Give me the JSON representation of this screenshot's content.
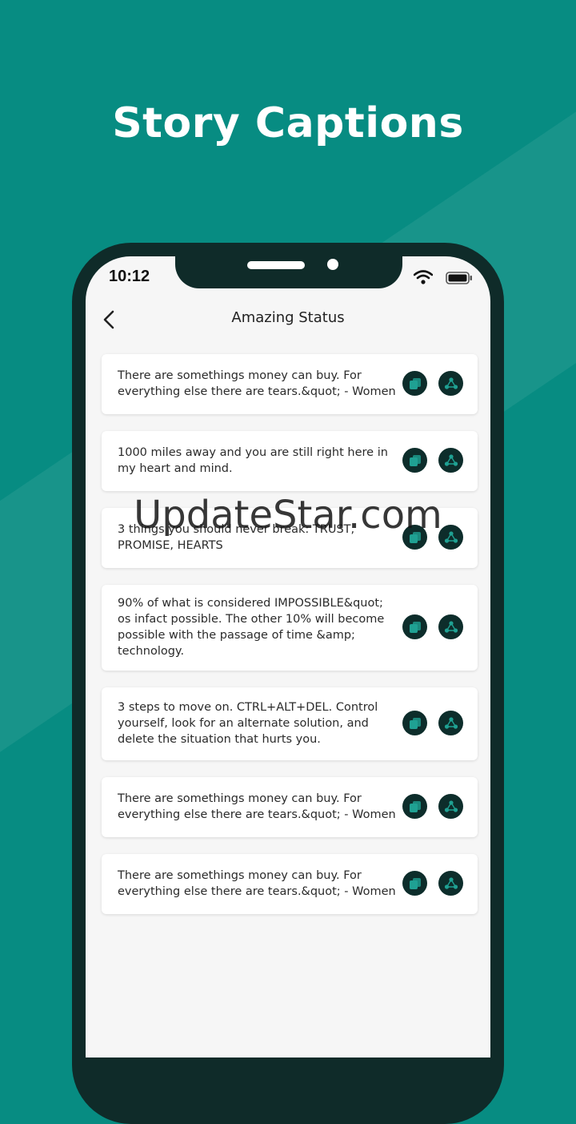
{
  "promo": {
    "title": "Story Captions"
  },
  "status_bar": {
    "time": "10:12"
  },
  "app_bar": {
    "title": "Amazing Status",
    "back_icon": "chevron-left-icon"
  },
  "captions": [
    {
      "text": "There are somethings money can buy. For everything else there are tears.&quot; - Women"
    },
    {
      "text": "1000 miles away and you are still right here in my heart and mind."
    },
    {
      "text": "3 things you should never break: TRUST, PROMISE, HEARTS"
    },
    {
      "text": "90% of what is considered IMPOSSIBLE&quot; os infact possible. The other 10% will become possible with the passage of time &amp; technology."
    },
    {
      "text": "3 steps to move on. CTRL+ALT+DEL. Control yourself, look for an alternate solution, and delete the situation that hurts you."
    },
    {
      "text": "There are somethings money can buy. For everything else there are tears.&quot; - Women"
    },
    {
      "text": "There are somethings money can buy. For everything else there are tears.&quot; - Women"
    }
  ],
  "actions": {
    "copy_icon": "copy-icon",
    "share_icon": "share-icon"
  },
  "watermark": {
    "text": "UpdateStar.com"
  },
  "colors": {
    "background": "#078c82",
    "phone_frame": "#0f2b29",
    "icon_button": "#0d2d2b",
    "icon_glyph": "#1fa193"
  }
}
